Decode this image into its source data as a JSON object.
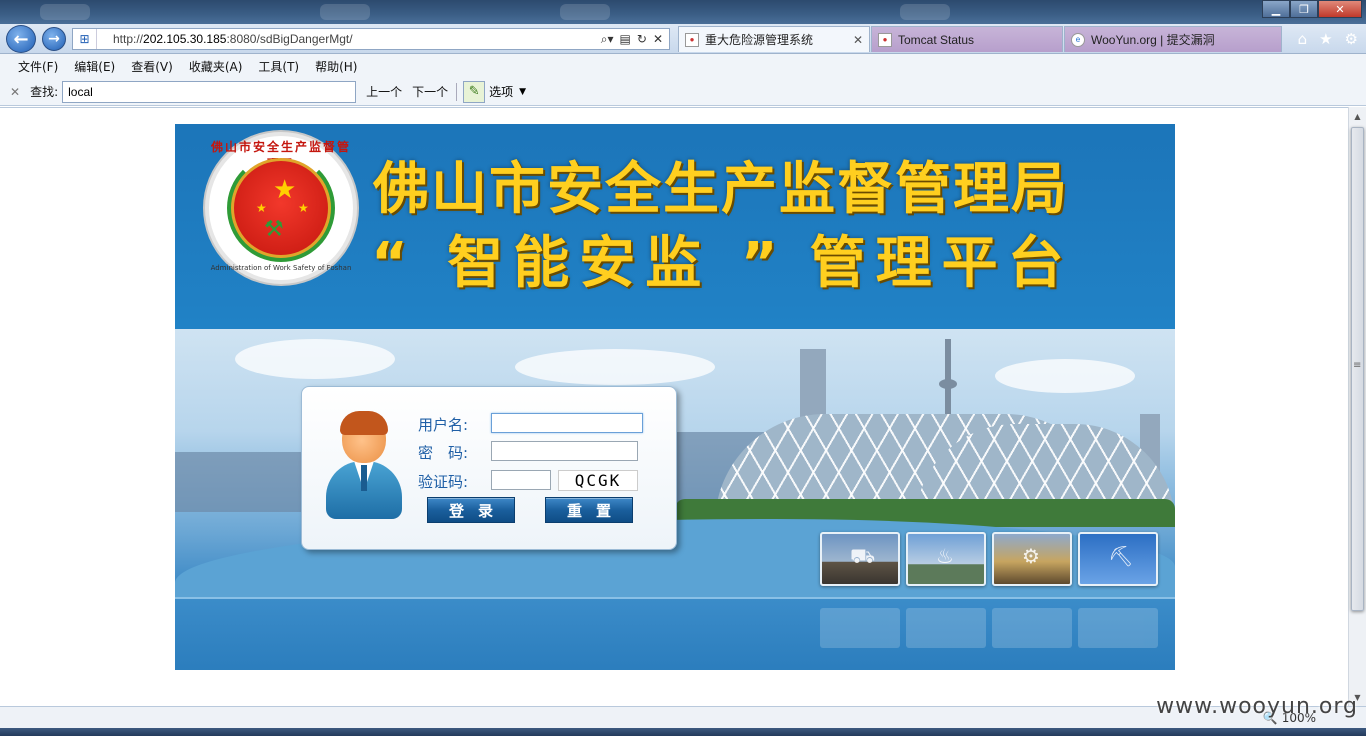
{
  "browser": {
    "url_prefix": "http://",
    "url_host": "202.105.30.185",
    "url_rest": ":8080/sdBigDangerMgt/",
    "tabs": [
      {
        "label": "重大危险源管理系统",
        "active": true
      },
      {
        "label": "Tomcat Status",
        "active": false
      },
      {
        "label": "WooYun.org | 提交漏洞",
        "active": false
      }
    ],
    "menu": [
      "文件(F)",
      "编辑(E)",
      "查看(V)",
      "收藏夹(A)",
      "工具(T)",
      "帮助(H)"
    ],
    "find": {
      "label": "查找:",
      "value": "local",
      "prev": "上一个",
      "next": "下一个",
      "options": "选项"
    },
    "zoom": "100%",
    "watermark": "www.wooyun.org"
  },
  "page": {
    "title_line1": "佛山市安全生产监督管理局",
    "title_line2_quoted": "“ 智能安监 ”",
    "title_line2_rest": "管理平台",
    "emblem_cn": "佛山市安全生产监督管理局",
    "emblem_en": "Administration of Work Safety of Foshan"
  },
  "login": {
    "username_label": "用户名:",
    "password_label": "密　码:",
    "captcha_label": "验证码:",
    "username_value": "",
    "password_value": "",
    "captcha_value": "",
    "captcha_text": "QCGK",
    "login_button": "登录",
    "reset_button": "重置"
  },
  "colors": {
    "banner_blue": "#1f7dc1",
    "title_yellow": "#ffcf1f",
    "label_blue": "#1f5fa6"
  }
}
